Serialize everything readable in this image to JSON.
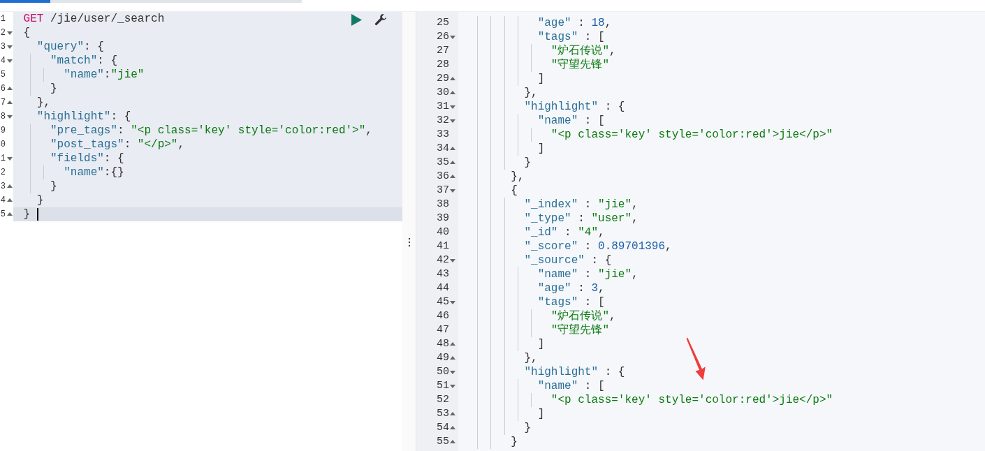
{
  "request_editor": {
    "lines": [
      {
        "num": "1",
        "kind": "plain",
        "active": false,
        "tokens": [
          {
            "kind": "method",
            "text": "GET"
          },
          {
            "kind": "url",
            "text": " /jie/user/_search"
          }
        ]
      },
      {
        "num": "2",
        "kind": "fold-open",
        "active": false,
        "tokens": [
          {
            "kind": "punct",
            "text": "{"
          }
        ]
      },
      {
        "num": "3",
        "kind": "fold-open",
        "active": false,
        "tokens": [
          {
            "kind": "key",
            "text": "  \"query\""
          },
          {
            "kind": "punct",
            "text": ": {"
          }
        ]
      },
      {
        "num": "4",
        "kind": "fold-open",
        "active": false,
        "tokens": [
          {
            "kind": "key",
            "text": "    \"match\""
          },
          {
            "kind": "punct",
            "text": ": {"
          }
        ]
      },
      {
        "num": "5",
        "kind": "plain",
        "active": false,
        "tokens": [
          {
            "kind": "key",
            "text": "      \"name\""
          },
          {
            "kind": "punct",
            "text": ":"
          },
          {
            "kind": "str",
            "text": "\"jie\""
          }
        ]
      },
      {
        "num": "6",
        "kind": "fold-close",
        "active": false,
        "tokens": [
          {
            "kind": "punct",
            "text": "    }"
          }
        ]
      },
      {
        "num": "7",
        "kind": "fold-close",
        "active": false,
        "tokens": [
          {
            "kind": "punct",
            "text": "  },"
          }
        ]
      },
      {
        "num": "8",
        "kind": "fold-open",
        "active": false,
        "tokens": [
          {
            "kind": "key",
            "text": "  \"highlight\""
          },
          {
            "kind": "punct",
            "text": ": {"
          }
        ]
      },
      {
        "num": "9",
        "kind": "plain",
        "active": false,
        "tokens": [
          {
            "kind": "key",
            "text": "    \"pre_tags\""
          },
          {
            "kind": "punct",
            "text": ": "
          },
          {
            "kind": "str",
            "text": "\"<p class='key' style='color:red'>\""
          },
          {
            "kind": "punct",
            "text": ","
          }
        ]
      },
      {
        "num": "0",
        "kind": "plain",
        "active": false,
        "tokens": [
          {
            "kind": "key",
            "text": "    \"post_tags\""
          },
          {
            "kind": "punct",
            "text": ": "
          },
          {
            "kind": "str",
            "text": "\"</p>\""
          },
          {
            "kind": "punct",
            "text": ","
          }
        ]
      },
      {
        "num": "1",
        "kind": "fold-open",
        "active": false,
        "tokens": [
          {
            "kind": "key",
            "text": "    \"fields\""
          },
          {
            "kind": "punct",
            "text": ": {"
          }
        ]
      },
      {
        "num": "2",
        "kind": "plain",
        "active": false,
        "tokens": [
          {
            "kind": "key",
            "text": "      \"name\""
          },
          {
            "kind": "punct",
            "text": ":{}"
          }
        ]
      },
      {
        "num": "3",
        "kind": "fold-close",
        "active": false,
        "tokens": [
          {
            "kind": "punct",
            "text": "    }"
          }
        ]
      },
      {
        "num": "4",
        "kind": "fold-close",
        "active": false,
        "tokens": [
          {
            "kind": "punct",
            "text": "  }"
          }
        ]
      },
      {
        "num": "5",
        "kind": "fold-close",
        "active": true,
        "tokens": [
          {
            "kind": "punct",
            "text": "}"
          }
        ]
      }
    ]
  },
  "response_viewer": {
    "lines": [
      {
        "num": "25",
        "kind": "plain",
        "tokens": [
          {
            "kind": "key",
            "text": "          \"age\""
          },
          {
            "kind": "punct",
            "text": " : "
          },
          {
            "kind": "num",
            "text": "18"
          },
          {
            "kind": "punct",
            "text": ","
          }
        ]
      },
      {
        "num": "26",
        "kind": "fold-open",
        "tokens": [
          {
            "kind": "key",
            "text": "          \"tags\""
          },
          {
            "kind": "punct",
            "text": " : ["
          }
        ]
      },
      {
        "num": "27",
        "kind": "plain",
        "tokens": [
          {
            "kind": "str",
            "text": "            \"炉石传说\""
          },
          {
            "kind": "punct",
            "text": ","
          }
        ]
      },
      {
        "num": "28",
        "kind": "plain",
        "tokens": [
          {
            "kind": "str",
            "text": "            \"守望先锋\""
          }
        ]
      },
      {
        "num": "29",
        "kind": "fold-close",
        "tokens": [
          {
            "kind": "punct",
            "text": "          ]"
          }
        ]
      },
      {
        "num": "30",
        "kind": "fold-close",
        "tokens": [
          {
            "kind": "punct",
            "text": "        },"
          }
        ]
      },
      {
        "num": "31",
        "kind": "fold-open",
        "tokens": [
          {
            "kind": "key",
            "text": "        \"highlight\""
          },
          {
            "kind": "punct",
            "text": " : {"
          }
        ]
      },
      {
        "num": "32",
        "kind": "fold-open",
        "tokens": [
          {
            "kind": "key",
            "text": "          \"name\""
          },
          {
            "kind": "punct",
            "text": " : ["
          }
        ]
      },
      {
        "num": "33",
        "kind": "plain",
        "tokens": [
          {
            "kind": "str",
            "text": "            \"<p class='key' style='color:red'>jie</p>\""
          }
        ]
      },
      {
        "num": "34",
        "kind": "fold-close",
        "tokens": [
          {
            "kind": "punct",
            "text": "          ]"
          }
        ]
      },
      {
        "num": "35",
        "kind": "fold-close",
        "tokens": [
          {
            "kind": "punct",
            "text": "        }"
          }
        ]
      },
      {
        "num": "36",
        "kind": "fold-close",
        "tokens": [
          {
            "kind": "punct",
            "text": "      },"
          }
        ]
      },
      {
        "num": "37",
        "kind": "fold-open",
        "tokens": [
          {
            "kind": "punct",
            "text": "      {"
          }
        ]
      },
      {
        "num": "38",
        "kind": "plain",
        "tokens": [
          {
            "kind": "key",
            "text": "        \"_index\""
          },
          {
            "kind": "punct",
            "text": " : "
          },
          {
            "kind": "str",
            "text": "\"jie\""
          },
          {
            "kind": "punct",
            "text": ","
          }
        ]
      },
      {
        "num": "39",
        "kind": "plain",
        "tokens": [
          {
            "kind": "key",
            "text": "        \"_type\""
          },
          {
            "kind": "punct",
            "text": " : "
          },
          {
            "kind": "str",
            "text": "\"user\""
          },
          {
            "kind": "punct",
            "text": ","
          }
        ]
      },
      {
        "num": "40",
        "kind": "plain",
        "tokens": [
          {
            "kind": "key",
            "text": "        \"_id\""
          },
          {
            "kind": "punct",
            "text": " : "
          },
          {
            "kind": "str",
            "text": "\"4\""
          },
          {
            "kind": "punct",
            "text": ","
          }
        ]
      },
      {
        "num": "41",
        "kind": "plain",
        "tokens": [
          {
            "kind": "key",
            "text": "        \"_score\""
          },
          {
            "kind": "punct",
            "text": " : "
          },
          {
            "kind": "num",
            "text": "0.89701396"
          },
          {
            "kind": "punct",
            "text": ","
          }
        ]
      },
      {
        "num": "42",
        "kind": "fold-open",
        "tokens": [
          {
            "kind": "key",
            "text": "        \"_source\""
          },
          {
            "kind": "punct",
            "text": " : {"
          }
        ]
      },
      {
        "num": "43",
        "kind": "plain",
        "tokens": [
          {
            "kind": "key",
            "text": "          \"name\""
          },
          {
            "kind": "punct",
            "text": " : "
          },
          {
            "kind": "str",
            "text": "\"jie\""
          },
          {
            "kind": "punct",
            "text": ","
          }
        ]
      },
      {
        "num": "44",
        "kind": "plain",
        "tokens": [
          {
            "kind": "key",
            "text": "          \"age\""
          },
          {
            "kind": "punct",
            "text": " : "
          },
          {
            "kind": "num",
            "text": "3"
          },
          {
            "kind": "punct",
            "text": ","
          }
        ]
      },
      {
        "num": "45",
        "kind": "fold-open",
        "tokens": [
          {
            "kind": "key",
            "text": "          \"tags\""
          },
          {
            "kind": "punct",
            "text": " : ["
          }
        ]
      },
      {
        "num": "46",
        "kind": "plain",
        "tokens": [
          {
            "kind": "str",
            "text": "            \"炉石传说\""
          },
          {
            "kind": "punct",
            "text": ","
          }
        ]
      },
      {
        "num": "47",
        "kind": "plain",
        "tokens": [
          {
            "kind": "str",
            "text": "            \"守望先锋\""
          }
        ]
      },
      {
        "num": "48",
        "kind": "fold-close",
        "tokens": [
          {
            "kind": "punct",
            "text": "          ]"
          }
        ]
      },
      {
        "num": "49",
        "kind": "fold-close",
        "tokens": [
          {
            "kind": "punct",
            "text": "        },"
          }
        ]
      },
      {
        "num": "50",
        "kind": "fold-open",
        "tokens": [
          {
            "kind": "key",
            "text": "        \"highlight\""
          },
          {
            "kind": "punct",
            "text": " : {"
          }
        ]
      },
      {
        "num": "51",
        "kind": "fold-open",
        "tokens": [
          {
            "kind": "key",
            "text": "          \"name\""
          },
          {
            "kind": "punct",
            "text": " : ["
          }
        ]
      },
      {
        "num": "52",
        "kind": "plain",
        "tokens": [
          {
            "kind": "str",
            "text": "            \"<p class='key' style='color:red'>jie</p>\""
          }
        ]
      },
      {
        "num": "53",
        "kind": "fold-close",
        "tokens": [
          {
            "kind": "punct",
            "text": "          ]"
          }
        ]
      },
      {
        "num": "54",
        "kind": "fold-close",
        "tokens": [
          {
            "kind": "punct",
            "text": "        }"
          }
        ]
      },
      {
        "num": "55",
        "kind": "fold-close",
        "tokens": [
          {
            "kind": "punct",
            "text": "      }"
          }
        ]
      }
    ]
  }
}
